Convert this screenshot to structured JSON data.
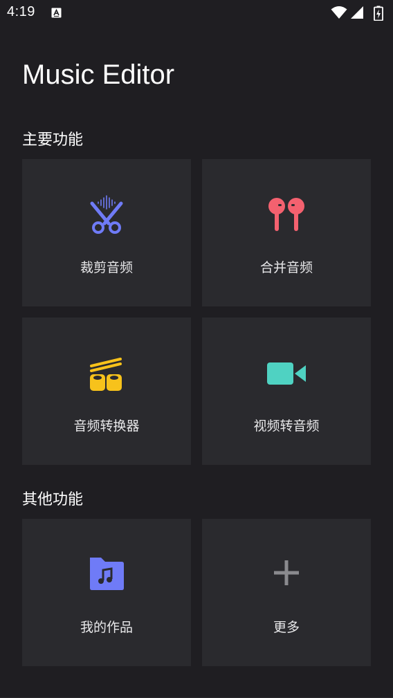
{
  "status_bar": {
    "time": "4:19",
    "notification_icon": "a-letter-icon",
    "icons": [
      "wifi-icon",
      "cell-signal-icon",
      "battery-icon"
    ]
  },
  "app": {
    "title": "Music Editor"
  },
  "sections": {
    "main": {
      "title": "主要功能",
      "cards": [
        {
          "label": "裁剪音频",
          "icon": "scissors-waveform-icon",
          "color": "#6f7bf7"
        },
        {
          "label": "合并音频",
          "icon": "earbuds-icon",
          "color": "#f4616f"
        },
        {
          "label": "音频转换器",
          "icon": "film-reels-icon",
          "color": "#f7c21b"
        },
        {
          "label": "视频转音频",
          "icon": "video-camera-icon",
          "color": "#4fd2c2"
        }
      ]
    },
    "other": {
      "title": "其他功能",
      "cards": [
        {
          "label": "我的作品",
          "icon": "music-folder-icon",
          "color": "#6f7bf7"
        },
        {
          "label": "更多",
          "icon": "plus-icon",
          "color": "#8a8a8e"
        }
      ]
    }
  },
  "colors": {
    "background": "#1f1e22",
    "card": "#2a2a2e",
    "text": "#ffffff"
  }
}
